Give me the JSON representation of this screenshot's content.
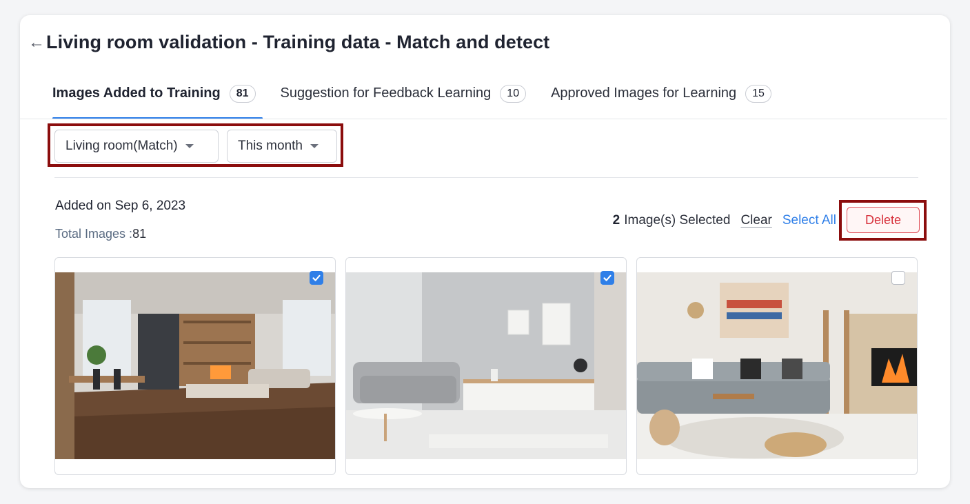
{
  "header": {
    "back_icon": "←",
    "title": "Living room validation - Training data - Match and detect"
  },
  "tabs": [
    {
      "label": "Images Added to Training",
      "count": "81",
      "active": true
    },
    {
      "label": "Suggestion for Feedback Learning",
      "count": "10",
      "active": false
    },
    {
      "label": "Approved Images for Learning",
      "count": "15",
      "active": false
    }
  ],
  "filters": {
    "category": "Living room(Match)",
    "period": "This month"
  },
  "group": {
    "added_on": "Added on Sep 6, 2023",
    "total_label": "Total Images :",
    "total_value": "81"
  },
  "selection": {
    "count": "2",
    "text": "Image(s) Selected",
    "clear": "Clear",
    "select_all": "Select All",
    "delete": "Delete"
  },
  "images": [
    {
      "description": "modern living room with wood floor and dining table",
      "selected": true
    },
    {
      "description": "grey sofa living room with white sideboard",
      "selected": true
    },
    {
      "description": "cozy living room with fireplace and sectional sofa",
      "selected": false
    }
  ],
  "colors": {
    "accent": "#2f7fe8",
    "danger": "#d7303b",
    "highlight_frame": "#8b0d0d"
  },
  "icons": {
    "back": "back-arrow-icon",
    "dropdown": "caret-down-icon",
    "checkbox": "checkmark-icon"
  }
}
